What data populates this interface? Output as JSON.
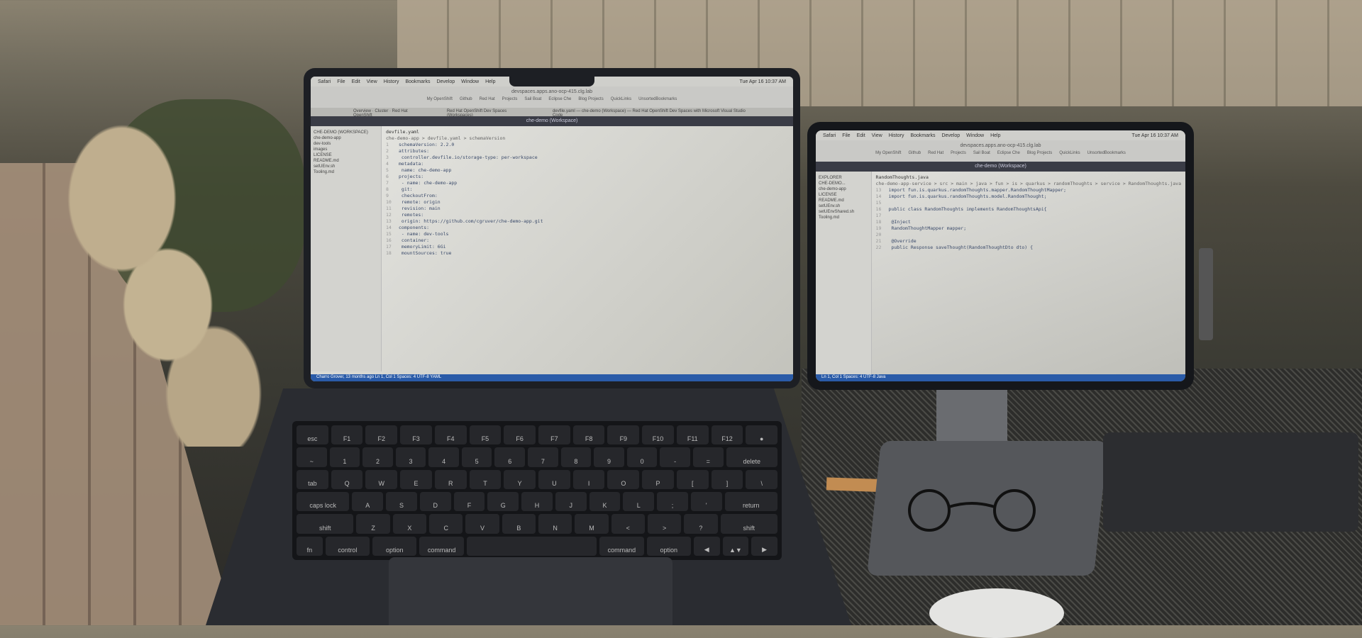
{
  "laptop": {
    "menubar": {
      "items": [
        "Safari",
        "File",
        "Edit",
        "View",
        "History",
        "Bookmarks",
        "Develop",
        "Window",
        "Help"
      ],
      "clock": "Tue Apr 16 10:37 AM"
    },
    "url": "devspaces.apps.ano-ocp-415.clg.lab",
    "bookmarks": [
      "My OpenShift",
      "Github",
      "Red Hat",
      "Projects",
      "Sail Boat",
      "Eclipse Che",
      "Blog Projects",
      "QuickLinks",
      "UnsortedBookmarks"
    ],
    "tabs": [
      "Overview · Cluster · Red Hat OpenShift",
      "Red Hat OpenShift Dev Spaces (Workspaces)",
      "devfile.yaml — che-demo (Workspace) — Red Hat OpenShift Dev Spaces with Microsoft Visual Studio Code"
    ],
    "workspace_title": "che-demo (Workspace)",
    "editor_tab": "devfile.yaml",
    "breadcrumb": "che-demo-app > devfile.yaml > schemaVersion",
    "sidebar": [
      "CHE-DEMO (WORKSPACE)",
      "che-demo-app",
      "dev-tools",
      "images",
      "LICENSE",
      "README.md",
      "setUEnv.sh",
      "Tooling.md"
    ],
    "code": [
      {
        "n": "1",
        "t": "schemaVersion: 2.2.0"
      },
      {
        "n": "2",
        "t": "attributes:"
      },
      {
        "n": "3",
        "t": "  controller.devfile.io/storage-type: per-workspace"
      },
      {
        "n": "4",
        "t": "metadata:"
      },
      {
        "n": "5",
        "t": "  name: che-demo-app"
      },
      {
        "n": "6",
        "t": "projects:"
      },
      {
        "n": "7",
        "t": "  - name: che-demo-app"
      },
      {
        "n": "8",
        "t": "    git:"
      },
      {
        "n": "9",
        "t": "      checkoutFrom:"
      },
      {
        "n": "10",
        "t": "        remote: origin"
      },
      {
        "n": "11",
        "t": "        revision: main"
      },
      {
        "n": "12",
        "t": "      remotes:"
      },
      {
        "n": "13",
        "t": "        origin: https://github.com/cgruver/che-demo-app.git"
      },
      {
        "n": "14",
        "t": "components:"
      },
      {
        "n": "15",
        "t": "  - name: dev-tools"
      },
      {
        "n": "16",
        "t": "    container:"
      },
      {
        "n": "17",
        "t": "      memoryLimit: 6Gi"
      },
      {
        "n": "18",
        "t": "      mountSources: true"
      }
    ],
    "status": "Charro Grover, 13 months ago   Ln 1, Col 1   Spaces: 4   UTF-8   YAML"
  },
  "tablet": {
    "menubar": {
      "items": [
        "Safari",
        "File",
        "Edit",
        "View",
        "History",
        "Bookmarks",
        "Develop",
        "Window",
        "Help"
      ],
      "clock": "Tue Apr 16 10:37 AM"
    },
    "url": "devspaces.apps.ano-ocp-415.clg.lab",
    "bookmarks": [
      "My OpenShift",
      "Github",
      "Red Hat",
      "Projects",
      "Sail Boat",
      "Eclipse Che",
      "Blog Projects",
      "QuickLinks",
      "UnsortedBookmarks"
    ],
    "workspace_title": "che-demo (Workspace)",
    "explorer": "EXPLORER",
    "editor_tab": "RandomThoughts.java",
    "breadcrumb": "che-demo-app-service > src > main > java > fun > is > quarkus > randomThoughts > service > RandomThoughts.java",
    "sidebar": [
      "CHE-DEMO...",
      "che-demo-app",
      "LICENSE",
      "README.md",
      "setUEnv.sh",
      "setUEnvShared.sh",
      "Tooling.md"
    ],
    "code": [
      {
        "n": "13",
        "t": "import fun.is.quarkus.randomThoughts.mapper.RandomThoughtMapper;"
      },
      {
        "n": "14",
        "t": "import fun.is.quarkus.randomThoughts.model.RandomThought;"
      },
      {
        "n": "15",
        "t": ""
      },
      {
        "n": "16",
        "t": "public class RandomThoughts implements RandomThoughtsApi{"
      },
      {
        "n": "17",
        "t": ""
      },
      {
        "n": "18",
        "t": "    @Inject"
      },
      {
        "n": "19",
        "t": "    RandomThoughtMapper mapper;"
      },
      {
        "n": "20",
        "t": ""
      },
      {
        "n": "21",
        "t": "    @Override"
      },
      {
        "n": "22",
        "t": "    public Response saveThought(RandomThoughtDto dto) {"
      }
    ],
    "status": "Ln 1, Col 1   Spaces: 4   UTF-8   Java"
  },
  "keyboard": {
    "rows": [
      [
        "esc",
        "F1",
        "F2",
        "F3",
        "F4",
        "F5",
        "F6",
        "F7",
        "F8",
        "F9",
        "F10",
        "F11",
        "F12",
        "●"
      ],
      [
        "~",
        "1",
        "2",
        "3",
        "4",
        "5",
        "6",
        "7",
        "8",
        "9",
        "0",
        "-",
        "=",
        "delete"
      ],
      [
        "tab",
        "Q",
        "W",
        "E",
        "R",
        "T",
        "Y",
        "U",
        "I",
        "O",
        "P",
        "[",
        "]",
        "\\"
      ],
      [
        "caps lock",
        "A",
        "S",
        "D",
        "F",
        "G",
        "H",
        "J",
        "K",
        "L",
        ";",
        "'",
        "return"
      ],
      [
        "shift",
        "Z",
        "X",
        "C",
        "V",
        "B",
        "N",
        "M",
        "<",
        ">",
        "?",
        "shift"
      ],
      [
        "fn",
        "control",
        "option",
        "command",
        " ",
        "command",
        "option",
        "◀",
        "▲▼",
        "▶"
      ]
    ]
  }
}
